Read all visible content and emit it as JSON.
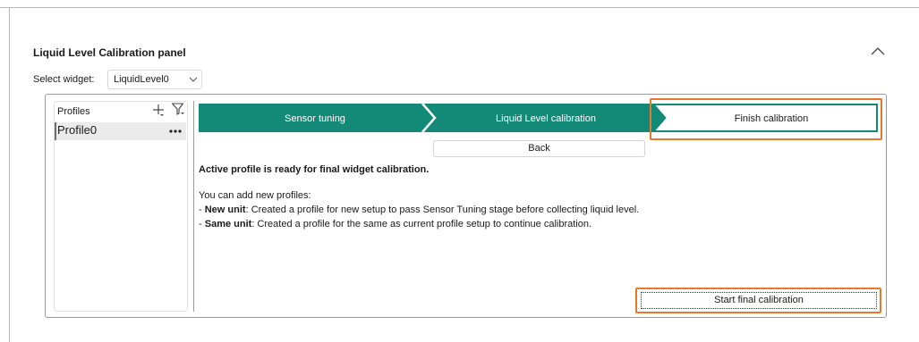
{
  "panel": {
    "title": "Liquid Level Calibration panel"
  },
  "widget_select": {
    "label": "Select widget:",
    "value": "LiquidLevel0"
  },
  "profiles": {
    "title": "Profiles",
    "items": [
      {
        "name": "Profile0",
        "selected": true
      }
    ]
  },
  "steps": [
    {
      "label": "Sensor tuning",
      "state": "done"
    },
    {
      "label": "Liquid Level calibration",
      "state": "done"
    },
    {
      "label": "Finish calibration",
      "state": "current"
    }
  ],
  "back_button": "Back",
  "message": {
    "headline": "Active profile is ready for final widget calibration.",
    "intro": "You can add new profiles:",
    "items": [
      {
        "prefix": "- ",
        "term": "New unit",
        "text": ": Created a profile for new setup to pass Sensor Tuning stage before collecting liquid level."
      },
      {
        "prefix": "- ",
        "term": "Same unit",
        "text": ": Created a profile for the same as current profile setup to continue calibration."
      }
    ]
  },
  "start_button": "Start final calibration",
  "colors": {
    "accent": "#138a77",
    "highlight": "#e8792b"
  }
}
